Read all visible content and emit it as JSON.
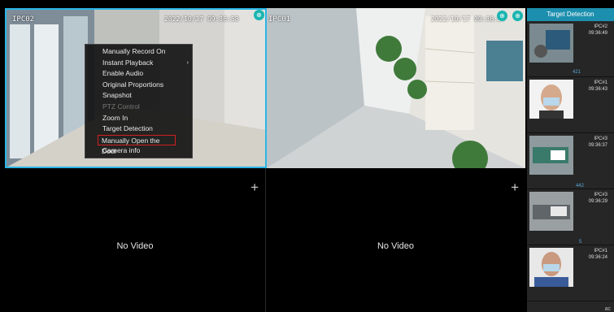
{
  "tiles": [
    {
      "title": "IPC02",
      "time": "2022/10/17 09:36:58",
      "badge": "⊕"
    },
    {
      "title": "IPC01",
      "time": "2022/10/17 09:36:57",
      "badge": "⊕"
    },
    {
      "novideo": "No Video",
      "plus": "+"
    },
    {
      "novideo": "No Video",
      "plus": "+"
    }
  ],
  "context_menu": {
    "items": [
      {
        "label": "Manually Record On"
      },
      {
        "label": "Instant Playback",
        "arrow": "›"
      },
      {
        "label": "Enable Audio"
      },
      {
        "label": "Original Proportions"
      },
      {
        "label": "Snapshot"
      },
      {
        "label": "PTZ Control",
        "disabled": true
      },
      {
        "label": "Zoom In"
      },
      {
        "label": "Target Detection"
      },
      {
        "label": "Manually Open the Door",
        "highlighted": true
      },
      {
        "label": "Camera info"
      }
    ]
  },
  "panel": {
    "title": "Target Detection",
    "detections": [
      {
        "camera": "IPC#2",
        "time": "09:36:49",
        "tag": "421"
      },
      {
        "camera": "IPC#1",
        "time": "09:36:43",
        "tag": ""
      },
      {
        "camera": "IPC#3",
        "time": "09:36:37",
        "tag": "442"
      },
      {
        "camera": "IPC#3",
        "time": "09:36:29",
        "tag": "5"
      },
      {
        "camera": "IPC#1",
        "time": "09:36:24",
        "tag": ""
      }
    ],
    "footer": "ac"
  },
  "colors": {
    "accent": "#2ab6e6",
    "panel_header": "#1d8fae",
    "highlight": "#d41f1f"
  }
}
